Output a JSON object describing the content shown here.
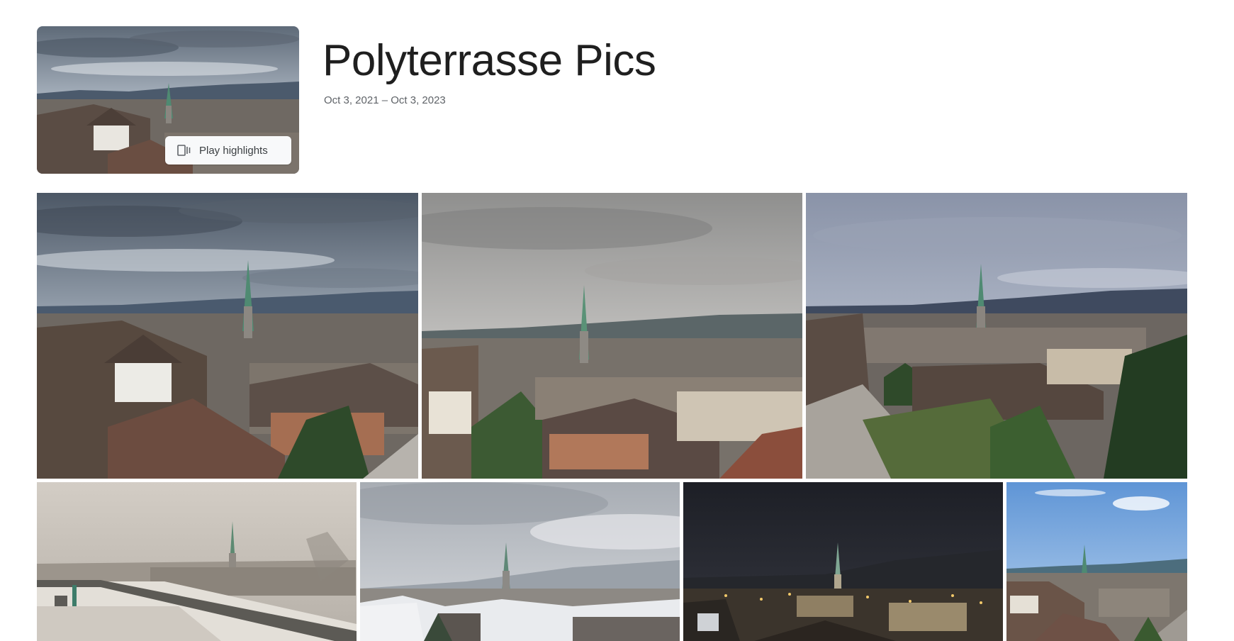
{
  "album": {
    "title": "Polyterrasse Pics",
    "date_range": "Oct 3, 2021 – Oct 3, 2023"
  },
  "cover": {
    "play_label": "Play highlights",
    "play_icon": "slideshow-icon"
  },
  "photos": [
    {
      "id": "photo-1",
      "scene": "cloudy-day"
    },
    {
      "id": "photo-2",
      "scene": "overcast"
    },
    {
      "id": "photo-3",
      "scene": "dusk"
    },
    {
      "id": "photo-4",
      "scene": "fog"
    },
    {
      "id": "photo-5",
      "scene": "snow"
    },
    {
      "id": "photo-6",
      "scene": "night"
    },
    {
      "id": "photo-7",
      "scene": "sunny"
    }
  ],
  "colors": {
    "background": "#ffffff",
    "title_text": "#1f1f1f",
    "date_text": "#5f6368",
    "play_button_bg": "#f8f9fa"
  }
}
